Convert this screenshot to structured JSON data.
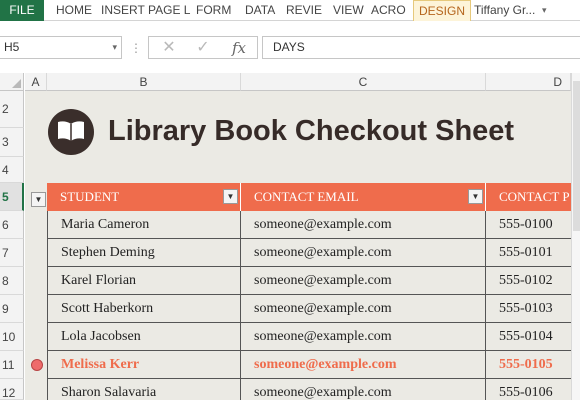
{
  "ribbon": {
    "file_label": "FILE",
    "tabs": [
      {
        "label": "HOME"
      },
      {
        "label": "INSERT"
      },
      {
        "label": "PAGE L"
      },
      {
        "label": "FORM"
      },
      {
        "label": "DATA"
      },
      {
        "label": "REVIE"
      },
      {
        "label": "VIEW"
      },
      {
        "label": "ACRO"
      },
      {
        "label": "DESIGN"
      }
    ],
    "user_name": "Tiffany Gr...",
    "user_chevron": "▾"
  },
  "formula_bar": {
    "name_box": "H5",
    "separator": "⋮",
    "cancel_icon": "✕",
    "enter_icon": "✓",
    "fx_label": "fx",
    "content": "DAYS"
  },
  "columns": [
    {
      "label": "A"
    },
    {
      "label": "B"
    },
    {
      "label": "C"
    },
    {
      "label": "D"
    }
  ],
  "rows": [
    {
      "label": "2"
    },
    {
      "label": "3"
    },
    {
      "label": "4"
    },
    {
      "label": "5"
    },
    {
      "label": "6"
    },
    {
      "label": "7"
    },
    {
      "label": "8"
    },
    {
      "label": "9"
    },
    {
      "label": "10"
    },
    {
      "label": "11"
    },
    {
      "label": "12"
    }
  ],
  "sheet": {
    "title": "Library Book Checkout Sheet",
    "logo_icon": "open-book-icon"
  },
  "table": {
    "headers": [
      "STUDENT",
      "CONTACT EMAIL",
      "CONTACT P"
    ],
    "filter_glyph": "▼",
    "rows": [
      {
        "student": "Maria Cameron",
        "email": "someone@example.com",
        "phone": "555-0100"
      },
      {
        "student": "Stephen Deming",
        "email": "someone@example.com",
        "phone": "555-0101"
      },
      {
        "student": "Karel Florian",
        "email": "someone@example.com",
        "phone": "555-0102"
      },
      {
        "student": "Scott Haberkorn",
        "email": "someone@example.com",
        "phone": "555-0103"
      },
      {
        "student": "Lola Jacobsen",
        "email": "someone@example.com",
        "phone": "555-0104"
      },
      {
        "student": "Melissa Kerr",
        "email": "someone@example.com",
        "phone": "555-0105"
      },
      {
        "student": "Sharon Salavaria",
        "email": "someone@example.com",
        "phone": "555-0106"
      }
    ],
    "highlighted_row_index": 5
  },
  "colors": {
    "excel_green": "#217346",
    "header_orange": "#ef6c4c",
    "title_brown": "#362b28",
    "sheet_bg": "#ebeae4",
    "marker_red": "#ee6b6b"
  }
}
